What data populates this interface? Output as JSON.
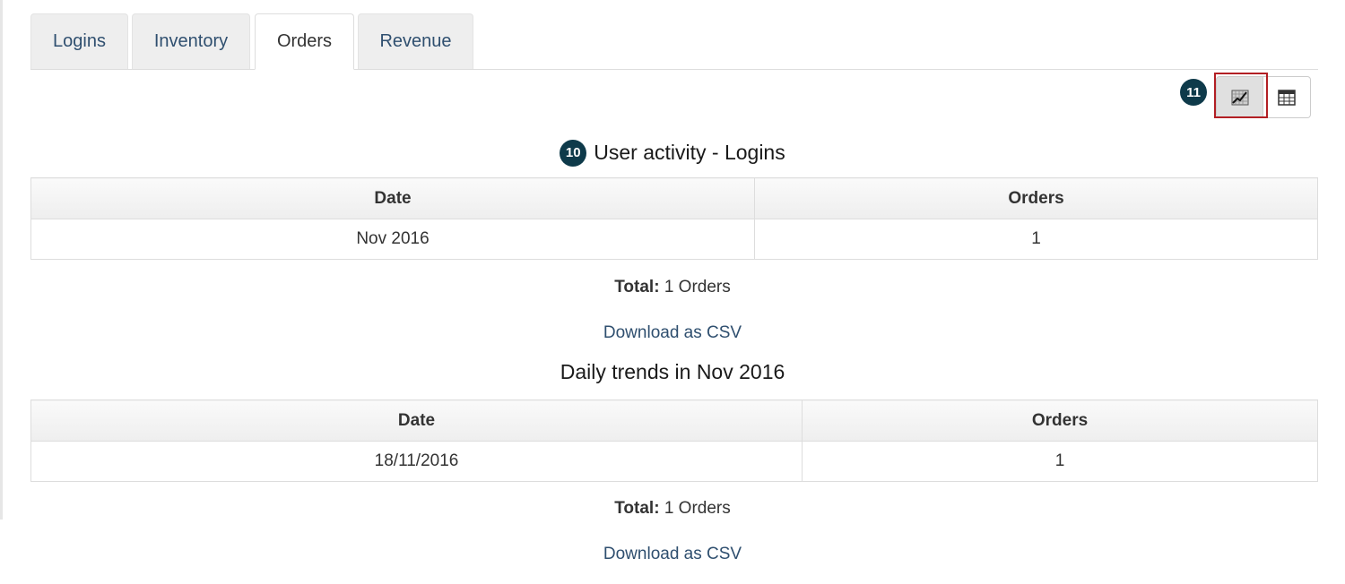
{
  "tabs": [
    {
      "label": "Logins",
      "active": false
    },
    {
      "label": "Inventory",
      "active": false
    },
    {
      "label": "Orders",
      "active": true
    },
    {
      "label": "Revenue",
      "active": false
    }
  ],
  "view_toggle": {
    "badge": "11",
    "chart_icon": "chart-icon",
    "table_icon": "table-icon",
    "selected": "chart"
  },
  "monthly": {
    "badge": "10",
    "title": "User activity - Logins",
    "columns": [
      "Date",
      "Orders"
    ],
    "rows": [
      [
        "Nov 2016",
        "1"
      ]
    ],
    "total_label": "Total:",
    "total_value": "1 Orders",
    "download_label": "Download as CSV"
  },
  "daily": {
    "title": "Daily trends in Nov 2016",
    "columns": [
      "Date",
      "Orders"
    ],
    "rows": [
      [
        "18/11/2016",
        "1"
      ]
    ],
    "total_label": "Total:",
    "total_value": "1 Orders",
    "download_label": "Download as CSV"
  },
  "colors": {
    "link": "#2f4f6f",
    "badge": "#0e3a4a",
    "highlight": "#b21f24"
  }
}
